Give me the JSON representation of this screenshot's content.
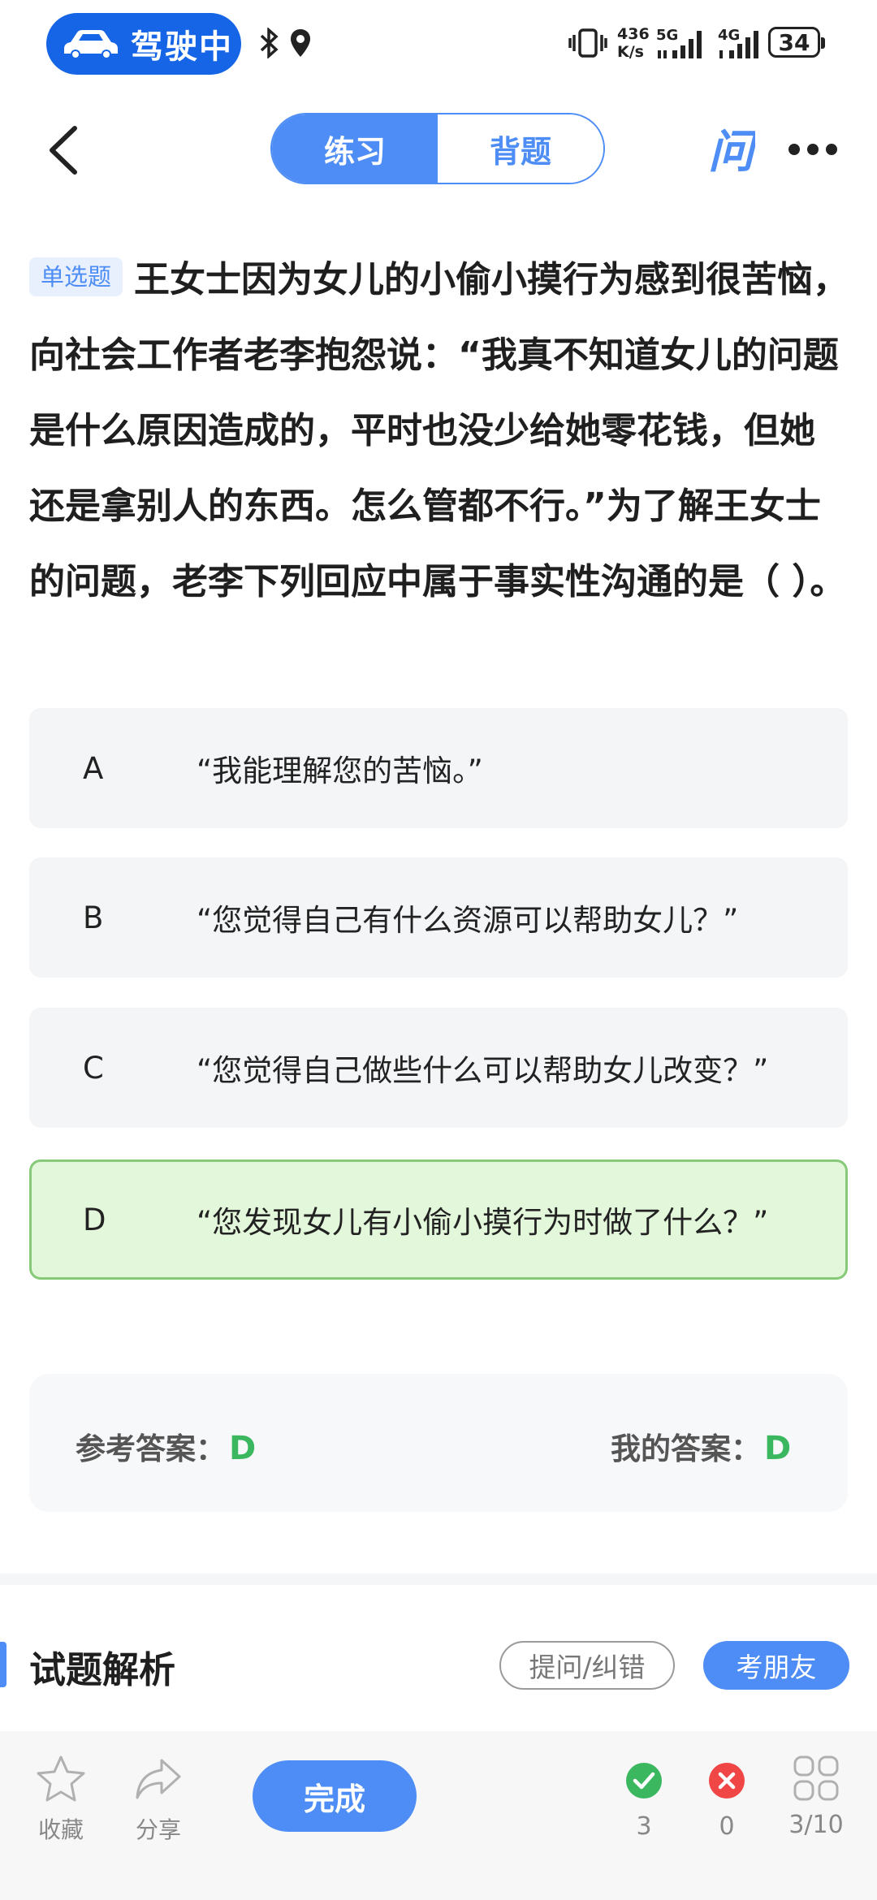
{
  "status_bar": {
    "driving_label": "驾驶中",
    "net_speed_value": "436",
    "net_speed_unit": "K/s",
    "network_1": "5G",
    "network_2": "4G",
    "battery": "34"
  },
  "nav": {
    "tabs": [
      {
        "label": "练习",
        "active": true
      },
      {
        "label": "背题",
        "active": false
      }
    ],
    "ask_icon_glyph": "问"
  },
  "question": {
    "type_badge": "单选题",
    "text": "王女士因为女儿的小偷小摸行为感到很苦恼，向社会工作者老李抱怨说：“我真不知道女儿的问题是什么原因造成的，平时也没少给她零花钱，但她还是拿别人的东西。怎么管都不行。”为了解王女士的问题，老李下列回应中属于事实性沟通的是（ ）。"
  },
  "options": [
    {
      "letter": "A",
      "text": "“我能理解您的苦恼。”"
    },
    {
      "letter": "B",
      "text": "“您觉得自己有什么资源可以帮助女儿？”"
    },
    {
      "letter": "C",
      "text": "“您觉得自己做些什么可以帮助女儿改变？”"
    },
    {
      "letter": "D",
      "text": "“您发现女儿有小偷小摸行为时做了什么？”"
    }
  ],
  "answer": {
    "reference_label": "参考答案：",
    "reference_value": "D",
    "mine_label": "我的答案：",
    "mine_value": "D"
  },
  "analysis": {
    "title": "试题解析",
    "ask_button": "提问/纠错",
    "friend_button": "考朋友"
  },
  "toolbar": {
    "favorite_label": "收藏",
    "share_label": "分享",
    "done_label": "完成",
    "correct_count": "3",
    "wrong_count": "0",
    "progress": "3/10"
  },
  "colors": {
    "accent": "#4d8df5",
    "correct": "#3bb85f",
    "wrong": "#f04646",
    "correct_option_bg": "#e3f7db"
  }
}
